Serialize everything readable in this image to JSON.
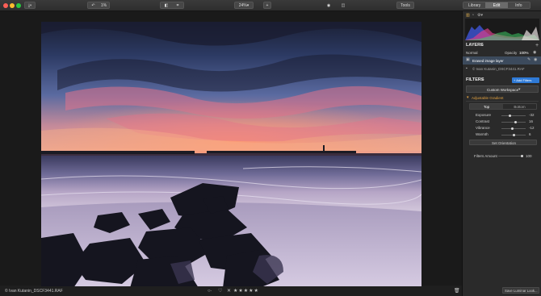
{
  "toolbar": {
    "zoom_label": "1%",
    "zoom_value": "24%",
    "zoom_in": "+",
    "tools_label": "Tools",
    "tabs": [
      "Library",
      "Edit",
      "Info"
    ],
    "active_tab": "Edit",
    "icons": [
      "import-icon",
      "undo-icon",
      "compare-icon",
      "crop-icon",
      "eye-icon",
      "split-view-icon"
    ]
  },
  "status_bar": {
    "filename": "© Ivan Kutanin_DSCF3441.RAF",
    "rating_stars": "★★★★★"
  },
  "panel": {
    "layers_title": "LAYERS",
    "blend_mode": "Normal",
    "opacity_label": "Opacity",
    "opacity_value": "100%",
    "layers": [
      {
        "name": "Erased image layer"
      },
      {
        "name": "© Ivan Kutanin_DSCF3441.RAF"
      }
    ],
    "filters_title": "FILTERS",
    "add_filters": "+ Add Filters",
    "workspace": "Custom Workspace",
    "gradient_title": "Adjustable Gradient",
    "gradient_tabs": [
      "Top",
      "Bottom"
    ],
    "sliders": [
      {
        "label": "Exposure",
        "value": "-32",
        "fraction": 0.34
      },
      {
        "label": "Contrast",
        "value": "16",
        "fraction": 0.58
      },
      {
        "label": "Vibrance",
        "value": "-12",
        "fraction": 0.44
      },
      {
        "label": "Warmth",
        "value": "6",
        "fraction": 0.53
      }
    ],
    "set_orientation": "Set Orientation",
    "filters_amount_label": "Filters Amount",
    "filters_amount_value": "100",
    "save_look": "Save Luminar Look..."
  },
  "colors": {
    "accent": "#2f7ad6",
    "layer_selected": "#3c4a5c"
  }
}
